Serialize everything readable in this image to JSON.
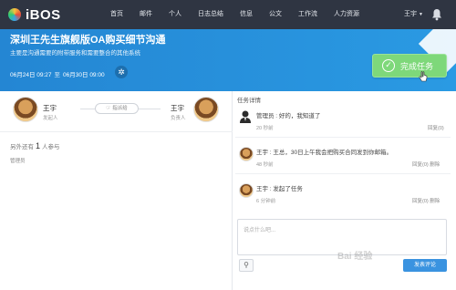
{
  "app": {
    "logo_text": "iBOS"
  },
  "nav": {
    "items": [
      "首页",
      "邮件",
      "个人",
      "日志总结",
      "信息",
      "公文",
      "工作流",
      "人力资源"
    ],
    "user": "王宇"
  },
  "banner": {
    "title": "深圳王先生旗舰版OA购买细节沟通",
    "subtitle": "主要是沟通需要的附带服务和需要整合的其他系统",
    "start": "06月24日 09:27",
    "sep": "至",
    "end": "06月30日 09:00",
    "complete_label": "完成任务"
  },
  "assignment": {
    "creator": {
      "name": "王宇",
      "role": "发起人"
    },
    "assign_label": "指派给",
    "owner": {
      "name": "王宇",
      "role": "负责人"
    }
  },
  "participants": {
    "prefix": "另外还有",
    "count": "1",
    "suffix": "人参与",
    "names": [
      "管理员"
    ]
  },
  "activity": {
    "title": "任务详情",
    "comments": [
      {
        "text": "管理员 :  好的，我知道了",
        "time": "20 秒前",
        "actions": "回复(0)"
      },
      {
        "text": "王宇 :  王总，30日上午我会把购买合同发到你邮箱。",
        "time": "48 秒前",
        "actions": "回复(0)    删除"
      },
      {
        "text": "王宇 :  发起了任务",
        "time": "6 分钟前",
        "actions": "回复(0)    删除"
      }
    ]
  },
  "reply": {
    "placeholder": "说点什么吧...",
    "submit_label": "发表评论"
  },
  "watermark": "Bai 经验"
}
